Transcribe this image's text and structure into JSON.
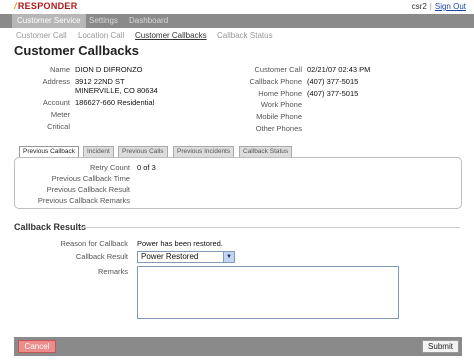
{
  "app": {
    "logo_text": "RESPONDER",
    "username": "csr2",
    "separator": "|",
    "signout_label": "Sign Out"
  },
  "nav": {
    "items": [
      {
        "label": "Customer Service"
      },
      {
        "label": "Settings"
      },
      {
        "label": "Dashboard"
      }
    ]
  },
  "subnav": {
    "items": [
      {
        "label": "Customer Call"
      },
      {
        "label": "Location Call"
      },
      {
        "label": "Customer Callbacks"
      },
      {
        "label": "Callback Status"
      }
    ]
  },
  "page": {
    "title": "Customer Callbacks"
  },
  "customer": {
    "name_label": "Name",
    "name": "DION D DIFRONZO",
    "address_label": "Address",
    "address_line1": "3912 22ND ST",
    "address_line2": "MINERVILLE, CO 80634",
    "account_label": "Account",
    "account": "186627-660 Residential",
    "meter_label": "Meter",
    "meter": "",
    "critical_label": "Critical",
    "critical": ""
  },
  "contact": {
    "customer_call_label": "Customer Call",
    "customer_call": "02/21/07 02:43 PM",
    "callback_phone_label": "Callback Phone",
    "callback_phone": "(407) 377-5015",
    "home_phone_label": "Home Phone",
    "home_phone": "(407) 377-5015",
    "work_phone_label": "Work Phone",
    "work_phone": "",
    "mobile_phone_label": "Mobile Phone",
    "mobile_phone": "",
    "other_phone_label": "Other Phones",
    "other_phone": ""
  },
  "tabs": [
    {
      "label": "Previous Callback"
    },
    {
      "label": "Incident"
    },
    {
      "label": "Previous Calls"
    },
    {
      "label": "Previous Incidents"
    },
    {
      "label": "Callback Status"
    }
  ],
  "previous_callback": {
    "retry_count_label": "Retry Count",
    "retry_count": "0 of 3",
    "time_label": "Previous Callback Time",
    "time": "",
    "result_label": "Previous Callback Result",
    "result": "",
    "remarks_label": "Previous Callback Remarks",
    "remarks": ""
  },
  "callback_results": {
    "section_title": "Callback Results",
    "reason_label": "Reason for Callback",
    "reason": "Power has been restored.",
    "result_label": "Callback Result",
    "result_selected": "Power Restored",
    "remarks_label": "Remarks",
    "remarks_value": ""
  },
  "footer": {
    "cancel_label": "Cancel",
    "submit_label": "Submit"
  }
}
